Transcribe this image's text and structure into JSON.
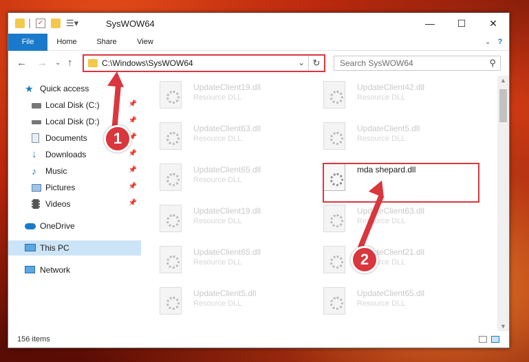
{
  "window": {
    "title": "SysWOW64"
  },
  "ribbon": {
    "tabs": [
      "File",
      "Home",
      "Share",
      "View"
    ]
  },
  "address": {
    "path": "C:\\Windows\\SysWOW64"
  },
  "search": {
    "placeholder": "Search SysWOW64"
  },
  "sidebar": {
    "items": [
      {
        "label": "Quick access",
        "icon": "star-icon"
      },
      {
        "label": "Local Disk (C:)",
        "icon": "drive-icon",
        "pinned": true
      },
      {
        "label": "Local Disk (D:)",
        "icon": "drive-icon",
        "pinned": true
      },
      {
        "label": "Documents",
        "icon": "documents-icon",
        "pinned": true
      },
      {
        "label": "Downloads",
        "icon": "downloads-icon",
        "pinned": true
      },
      {
        "label": "Music",
        "icon": "music-icon",
        "pinned": true
      },
      {
        "label": "Pictures",
        "icon": "pictures-icon",
        "pinned": true
      },
      {
        "label": "Videos",
        "icon": "videos-icon",
        "pinned": true
      },
      {
        "label": "OneDrive",
        "icon": "onedrive-icon"
      },
      {
        "label": "This PC",
        "icon": "computer-icon",
        "selected": true
      },
      {
        "label": "Network",
        "icon": "network-icon"
      }
    ]
  },
  "files": [
    {
      "name": "UpdateClient19.dll",
      "type": "Resource DLL"
    },
    {
      "name": "UpdateClient42.dll",
      "type": "Resource DLL"
    },
    {
      "name": "UpdateClient63.dll",
      "type": "Resource DLL"
    },
    {
      "name": "UpdateClient5.dll",
      "type": "Resource DLL"
    },
    {
      "name": "UpdateClient65.dll",
      "type": "Resource DLL"
    },
    {
      "name": "mda shepard.dll",
      "type": "",
      "highlighted": true
    },
    {
      "name": "UpdateClient19.dll",
      "type": "Resource DLL"
    },
    {
      "name": "UpdateClient63.dll",
      "type": "Resource DLL"
    },
    {
      "name": "UpdateClient65.dll",
      "type": "Resource DLL"
    },
    {
      "name": "UpdateClient21.dll",
      "type": "Resource DLL"
    },
    {
      "name": "UpdateClient5.dll",
      "type": "Resource DLL"
    },
    {
      "name": "UpdateClient65.dll",
      "type": "Resource DLL"
    }
  ],
  "status": {
    "count": "156 items"
  },
  "annotations": {
    "step1": "1",
    "step2": "2"
  },
  "colors": {
    "accent": "#1979ca",
    "highlight": "#d9363e"
  }
}
